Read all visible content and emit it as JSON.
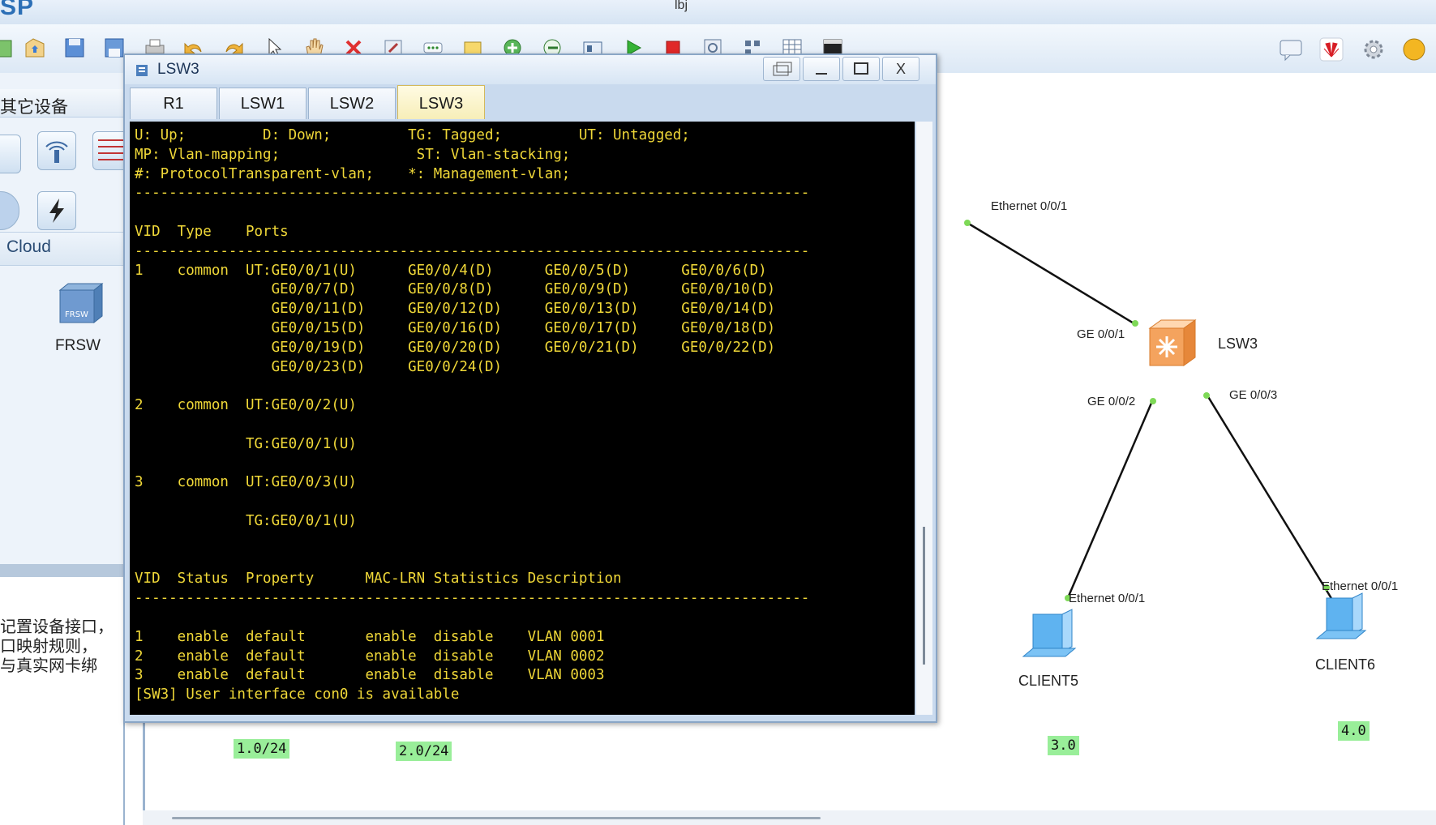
{
  "app": {
    "logo_text": "SP",
    "window_title": "lbj"
  },
  "toolbar": {
    "icons": [
      "new-icon",
      "open-icon",
      "save-icon",
      "save-as-icon",
      "print-icon",
      "undo-icon",
      "redo-icon",
      "select-icon",
      "hand-icon",
      "delete-icon",
      "settings-wrench-icon",
      "more-icon",
      "text-icon",
      "add-icon",
      "connect-icon",
      "topology-icon",
      "start-icon",
      "stop-icon",
      "capture-icon",
      "grid-icon",
      "table-icon",
      "terminal-icon"
    ],
    "right_icons": [
      "chat-icon",
      "huawei-icon",
      "gear-icon",
      "help-icon"
    ]
  },
  "left_panel": {
    "category_title": "其它设备",
    "cloud_label": "Cloud",
    "frsw_label": "FRSW",
    "frsw_icon_text": "FRSW",
    "description": "记置设备接口，\n口映射规则，\n与真实网卡绑"
  },
  "terminal_window": {
    "title": "LSW3",
    "controls": [
      "restore-icon",
      "minimize-icon",
      "maximize-icon",
      "close-icon"
    ],
    "close_label": "X",
    "tabs": [
      "R1",
      "LSW1",
      "LSW2",
      "LSW3"
    ],
    "active_tab": "LSW3",
    "output": "U: Up;         D: Down;         TG: Tagged;         UT: Untagged;\nMP: Vlan-mapping;                ST: Vlan-stacking;\n#: ProtocolTransparent-vlan;    *: Management-vlan;\n-------------------------------------------------------------------------------\n\nVID  Type    Ports\n-------------------------------------------------------------------------------\n1    common  UT:GE0/0/1(U)      GE0/0/4(D)      GE0/0/5(D)      GE0/0/6(D)\n                GE0/0/7(D)      GE0/0/8(D)      GE0/0/9(D)      GE0/0/10(D)\n                GE0/0/11(D)     GE0/0/12(D)     GE0/0/13(D)     GE0/0/14(D)\n                GE0/0/15(D)     GE0/0/16(D)     GE0/0/17(D)     GE0/0/18(D)\n                GE0/0/19(D)     GE0/0/20(D)     GE0/0/21(D)     GE0/0/22(D)\n                GE0/0/23(D)     GE0/0/24(D)\n\n2    common  UT:GE0/0/2(U)\n\n             TG:GE0/0/1(U)\n\n3    common  UT:GE0/0/3(U)\n\n             TG:GE0/0/1(U)\n\n\nVID  Status  Property      MAC-LRN Statistics Description\n-------------------------------------------------------------------------------\n\n1    enable  default       enable  disable    VLAN 0001\n2    enable  default       enable  disable    VLAN 0002\n3    enable  default       enable  disable    VLAN 0003\n[SW3] User interface con0 is available"
  },
  "topology": {
    "switch_label": "LSW3",
    "client5_label": "CLIENT5",
    "client6_label": "CLIENT6",
    "port_labels": {
      "eth_top": "Ethernet 0/0/1",
      "ge1": "GE 0/0/1",
      "ge2": "GE 0/0/2",
      "ge3": "GE 0/0/3",
      "client5_eth": "Ethernet 0/0/1",
      "client6_eth": "Ethernet 0/0/1"
    },
    "net_labels": [
      "1.0/24",
      "2.0/24",
      "3.0",
      "4.0"
    ],
    "link_color": "#111111",
    "port_dot_color": "#7ed957",
    "net_label_color": "#99ee99"
  }
}
